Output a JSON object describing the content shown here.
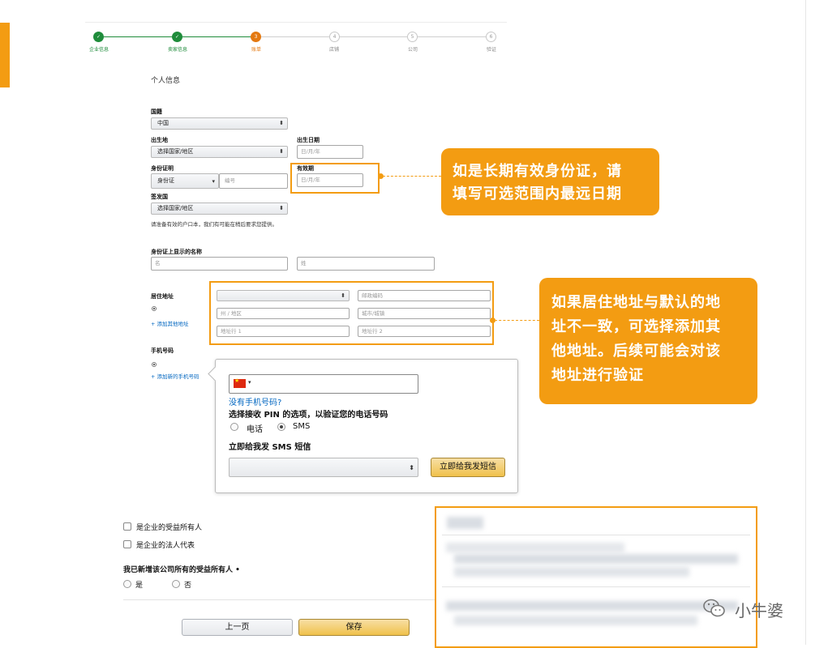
{
  "stepper": {
    "steps": [
      {
        "label": "企业信息",
        "number": "✓",
        "state": "done"
      },
      {
        "label": "卖家信息",
        "number": "✓",
        "state": "done"
      },
      {
        "label": "账单",
        "number": "3",
        "state": "current"
      },
      {
        "label": "店铺",
        "number": "4",
        "state": "todo"
      },
      {
        "label": "公司",
        "number": "5",
        "state": "todo"
      },
      {
        "label": "验证",
        "number": "6",
        "state": "todo"
      }
    ]
  },
  "form": {
    "section_title": "个人信息",
    "nationality": {
      "label": "国籍",
      "value": "中国"
    },
    "birthplace": {
      "label": "出生地",
      "value": "选择国家/地区"
    },
    "birthdate": {
      "label": "出生日期",
      "placeholder": "日/月/年"
    },
    "id_proof": {
      "label": "身份证明",
      "type_value": "身份证",
      "number_placeholder": "编号"
    },
    "expiry": {
      "label": "有效期",
      "placeholder": "日/月/年"
    },
    "issuing_country": {
      "label": "签发国",
      "value": "选择国家/地区"
    },
    "hint": "请准备有效的户口本，我们有可能在稍后要求您提供。",
    "name_on_id": {
      "label": "身份证上显示的名称",
      "first_placeholder": "名",
      "last_placeholder": "姓"
    },
    "address": {
      "label": "居住地址",
      "add_link": "+ 添加其他地址",
      "country_select": "",
      "postal_placeholder": "邮政编码",
      "province_placeholder": "州 / 地区",
      "city_placeholder": "城市/城镇",
      "line1_placeholder": "地址行 1",
      "line2_placeholder": "地址行 2"
    },
    "phone": {
      "label": "手机号码",
      "add_link": "+ 添加新的手机号码"
    },
    "checkboxes": {
      "beneficial_owner": "是企业的受益所有人",
      "legal_rep": "是企业的法人代表"
    },
    "added_all_owners": {
      "question": "我已新增该公司所有的受益所有人 •",
      "yes": "是",
      "no": "否"
    },
    "buttons": {
      "prev": "上一页",
      "save": "保存"
    }
  },
  "popover": {
    "no_phone_link": "没有手机号码?",
    "pin_title": "选择接收 PIN 的选项，以验证您的电话号码",
    "option_call": "电话",
    "option_sms": "SMS",
    "sms_title": "立即给我发 SMS 短信",
    "send_button": "立即给我发短信",
    "select_value": ""
  },
  "callouts": {
    "expiry_note": [
      "如是长期有效身份证，请",
      "填写可选范围内最远日期"
    ],
    "address_note": [
      "如果居住地址与默认的地",
      "址不一致，可选择添加其",
      "他地址。后续可能会对该",
      "地址进行验证"
    ]
  },
  "watermark": "小牛婆"
}
